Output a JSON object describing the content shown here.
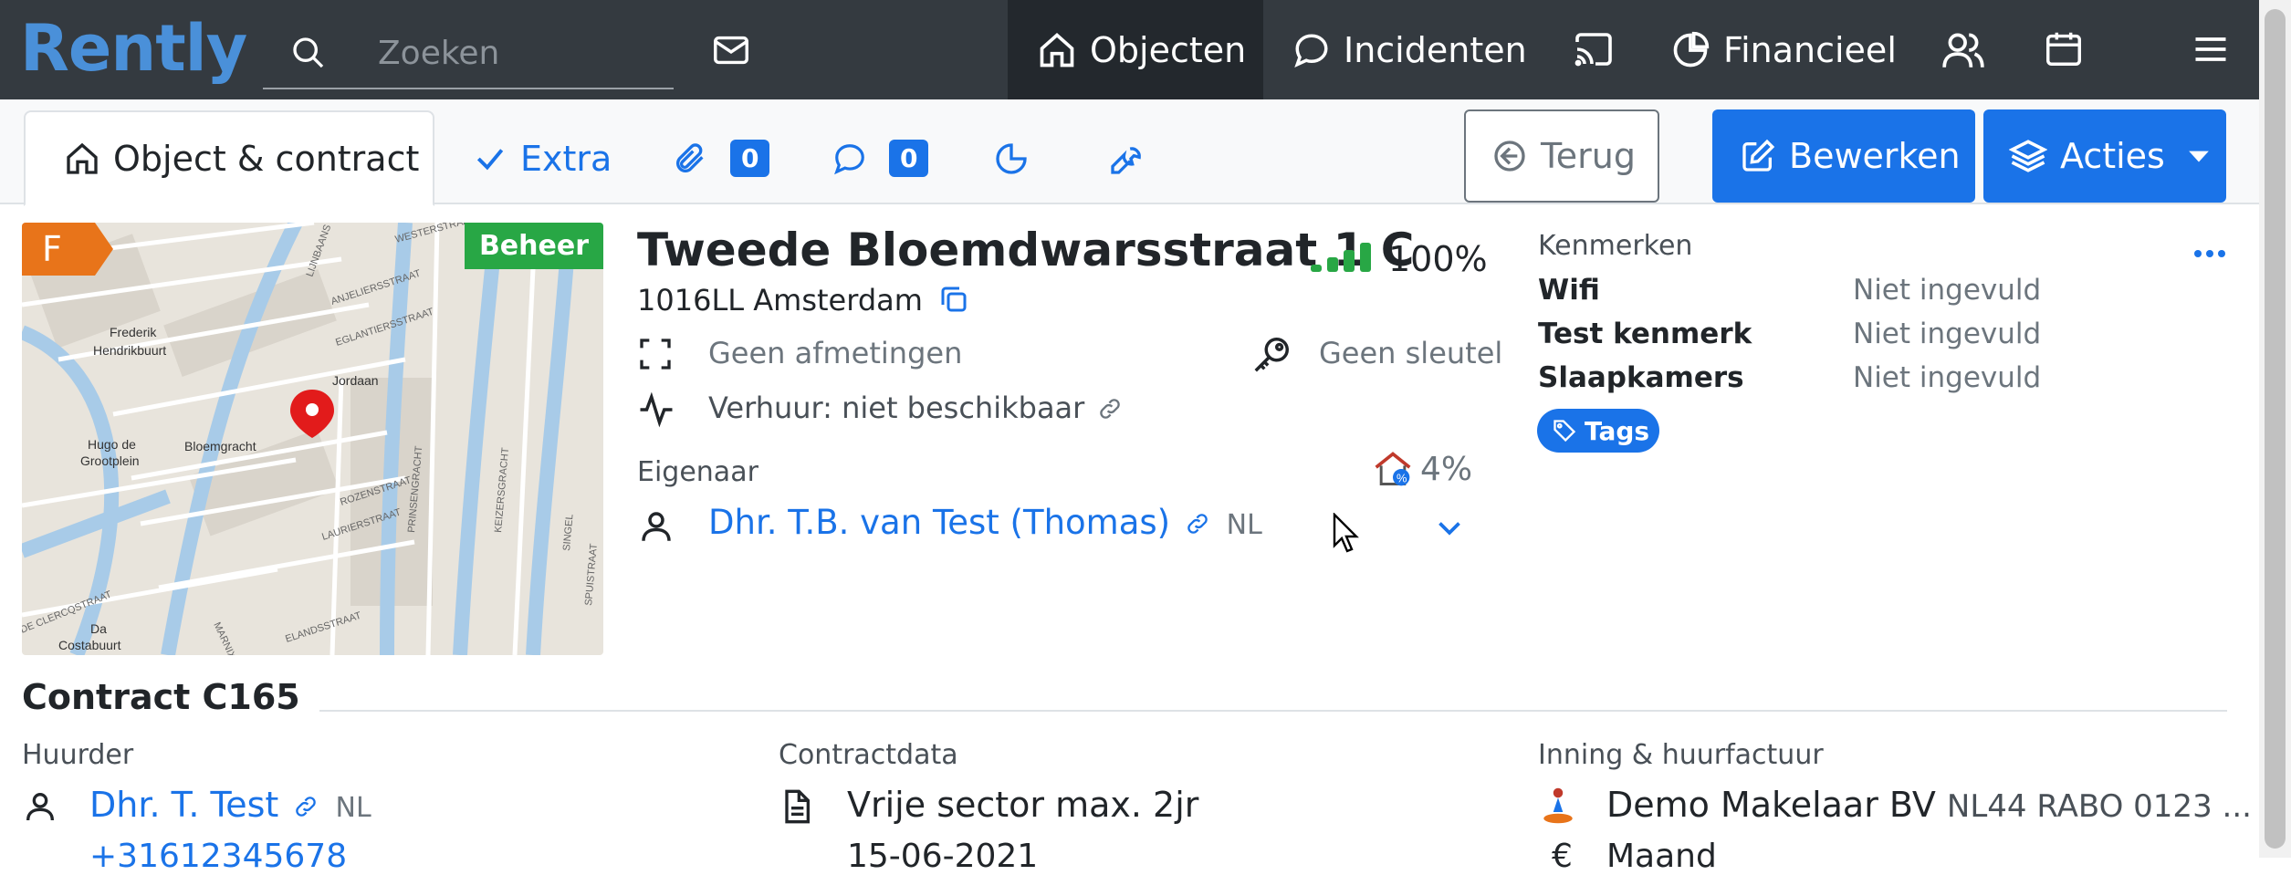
{
  "topbar": {
    "brand": "Rently",
    "search_placeholder": "Zoeken",
    "nav": [
      {
        "label": "Objecten",
        "icon": "home-icon",
        "active": true
      },
      {
        "label": "Incidenten",
        "icon": "chat-bubble-icon"
      },
      {
        "label": "Financieel",
        "icon": "pie-chart-icon"
      }
    ],
    "icons": [
      "search-icon",
      "mail-icon",
      "cast-icon",
      "users-icon",
      "calendar-icon",
      "menu-icon"
    ]
  },
  "tabs": {
    "object_contract": "Object & contract",
    "extra": "Extra",
    "attachments_count": "0",
    "comments_count": "0"
  },
  "buttons": {
    "terug": "Terug",
    "bewerken": "Bewerken",
    "acties": "Acties"
  },
  "map": {
    "flag": "F",
    "status": "Beheer",
    "labels": [
      "Frederik Hendrikbuurt",
      "Jordaan",
      "Bloemgracht",
      "Hugo de Grootplein",
      "Da Costabuurt",
      "WESTERSTRAAT",
      "ANJELIERSSTRAAT",
      "EGLANTIERSSTRAAT",
      "LIJNBAANS",
      "ROZENSTRAAT",
      "LAURIERSTRAAT",
      "ELANDSSTRAAT",
      "PRINSENGRACHT",
      "KEIZERSGRACHT",
      "SINGEL",
      "SPUISTRAAT",
      "MARNIXSTRAAT",
      "DE CLERCQSTRAAT"
    ]
  },
  "object": {
    "title": "Tweede Bloemdwarsstraat 1 C",
    "completeness": "100%",
    "postcode_city": "1016LL Amsterdam",
    "dimensions": "Geen afmetingen",
    "key": "Geen sleutel",
    "rental": "Verhuur: niet beschikbaar",
    "owner_label": "Eigenaar",
    "owner_share": "4%",
    "owner_name": "Dhr. T.B. van Test (Thomas)",
    "owner_lang": "NL"
  },
  "kenmerken": {
    "title": "Kenmerken",
    "items": [
      {
        "label": "Wifi",
        "value": "Niet ingevuld"
      },
      {
        "label": "Test kenmerk",
        "value": "Niet ingevuld"
      },
      {
        "label": "Slaapkamers",
        "value": "Niet ingevuld"
      }
    ],
    "tags_label": "Tags"
  },
  "contract": {
    "title": "Contract C165",
    "huurder_label": "Huurder",
    "huurder_name": "Dhr. T. Test",
    "huurder_lang": "NL",
    "huurder_phone": "+31612345678",
    "contractdata_label": "Contractdata",
    "contract_type": "Vrije sector max. 2jr",
    "contract_date": "15-06-2021",
    "inning_label": "Inning & huurfactuur",
    "inning_party": "Demo Makelaar BV",
    "inning_iban": "NL44 RABO 0123 ...",
    "inning_period": "Maand"
  },
  "colors": {
    "topbar": "#343a40",
    "brand": "#4a90d9",
    "primary": "#1a73e8",
    "beheer": "#28a745",
    "flag": "#e8741a",
    "signal": "#28a745"
  }
}
